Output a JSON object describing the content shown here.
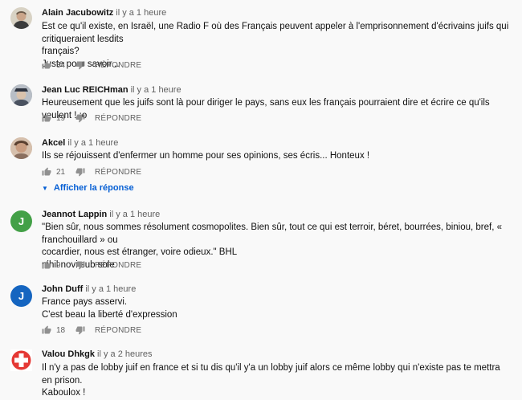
{
  "comments": [
    {
      "author": "Alain Jacubowitz",
      "time": "il y a 1 heure",
      "text_lines": [
        "Est ce qu'il existe, en Israël, une Radio F où des Français peuvent appeler à l'emprisonnement d'écrivains juifs qui critiqueraient lesdits",
        "français?",
        "Juste pour savoir..."
      ],
      "likes": "34",
      "reply_label": "RÉPONDRE",
      "avatar_color": "#cfc8b8"
    },
    {
      "author": "Jean Luc REICHman",
      "time": "il y a 1 heure",
      "text_lines": [
        "Heureusement que les juifs sont là pour diriger le pays, sans eux les français pourraient dire et écrire ce qu'ils veulent ! :o"
      ],
      "likes": "19",
      "reply_label": "RÉPONDRE",
      "avatar_color": "#9aa0a8"
    },
    {
      "author": "Akcel",
      "time": "il y a 1 heure",
      "text_lines": [
        "Ils se réjouissent d'enfermer un homme pour ses opinions, ses écris... Honteux !"
      ],
      "likes": "21",
      "reply_label": "RÉPONDRE",
      "show_replies": "Afficher la réponse",
      "avatar_color": "#c9a890"
    },
    {
      "author": "Jeannot Lappin",
      "time": "il y a 1 heure",
      "initial": "J",
      "text_lines": [
        "\"Bien sûr, nous sommes résolument cosmopolites. Bien sûr, tout ce qui est terroir, béret, bourrées, biniou, bref, « franchouillard » ou",
        "cocardier, nous est étranger, voire odieux.\" BHL",
        "nihil novi sub sole"
      ],
      "likes": "9",
      "reply_label": "RÉPONDRE",
      "avatar_color": "#43a047"
    },
    {
      "author": "John Duff",
      "time": "il y a 1 heure",
      "initial": "J",
      "text_lines": [
        "France pays asservi.",
        "C'est beau la liberté d'expression"
      ],
      "likes": "18",
      "reply_label": "RÉPONDRE",
      "avatar_color": "#1565c0"
    },
    {
      "author": "Valou Dhkgk",
      "time": "il y a 2 heures",
      "text_lines": [
        "Il n'y a pas de lobby juif en france et si tu dis qu'il y'a un lobby juif alors ce même lobby qui n'existe pas te mettra en prison.",
        "Kaboulox !"
      ],
      "avatar_color": "#e53935"
    }
  ]
}
